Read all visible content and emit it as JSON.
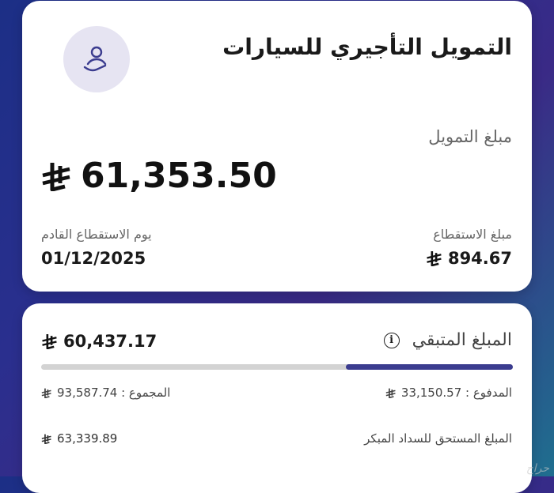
{
  "header": {
    "title": "التمويل التأجيري للسيارات"
  },
  "financing": {
    "label": "مبلغ التمويل",
    "amount": "61,353.50"
  },
  "next_payment": {
    "label": "يوم الاستقطاع القادم",
    "date": "01/12/2025"
  },
  "deduction": {
    "label": "مبلغ الاستقطاع",
    "amount": "894.67"
  },
  "remaining": {
    "label": "المبلغ المتبقي",
    "amount": "60,437.17",
    "paid_fraction": 0.354
  },
  "paid": {
    "text": "المدفوع : 33,150.57"
  },
  "total": {
    "text": "المجموع : 93,587.74"
  },
  "early_settlement": {
    "label": "المبلغ المستحق للسداد المبكر",
    "amount": "63,339.89"
  },
  "watermark": {
    "text": "حراج"
  },
  "colors": {
    "accent": "#3b3c8f",
    "track": "#d3d3d3",
    "avatar_bg": "#e6e4f2"
  },
  "icons": {
    "avatar": "person-hand-icon",
    "currency": "riyal-icon",
    "info": "info-icon"
  }
}
